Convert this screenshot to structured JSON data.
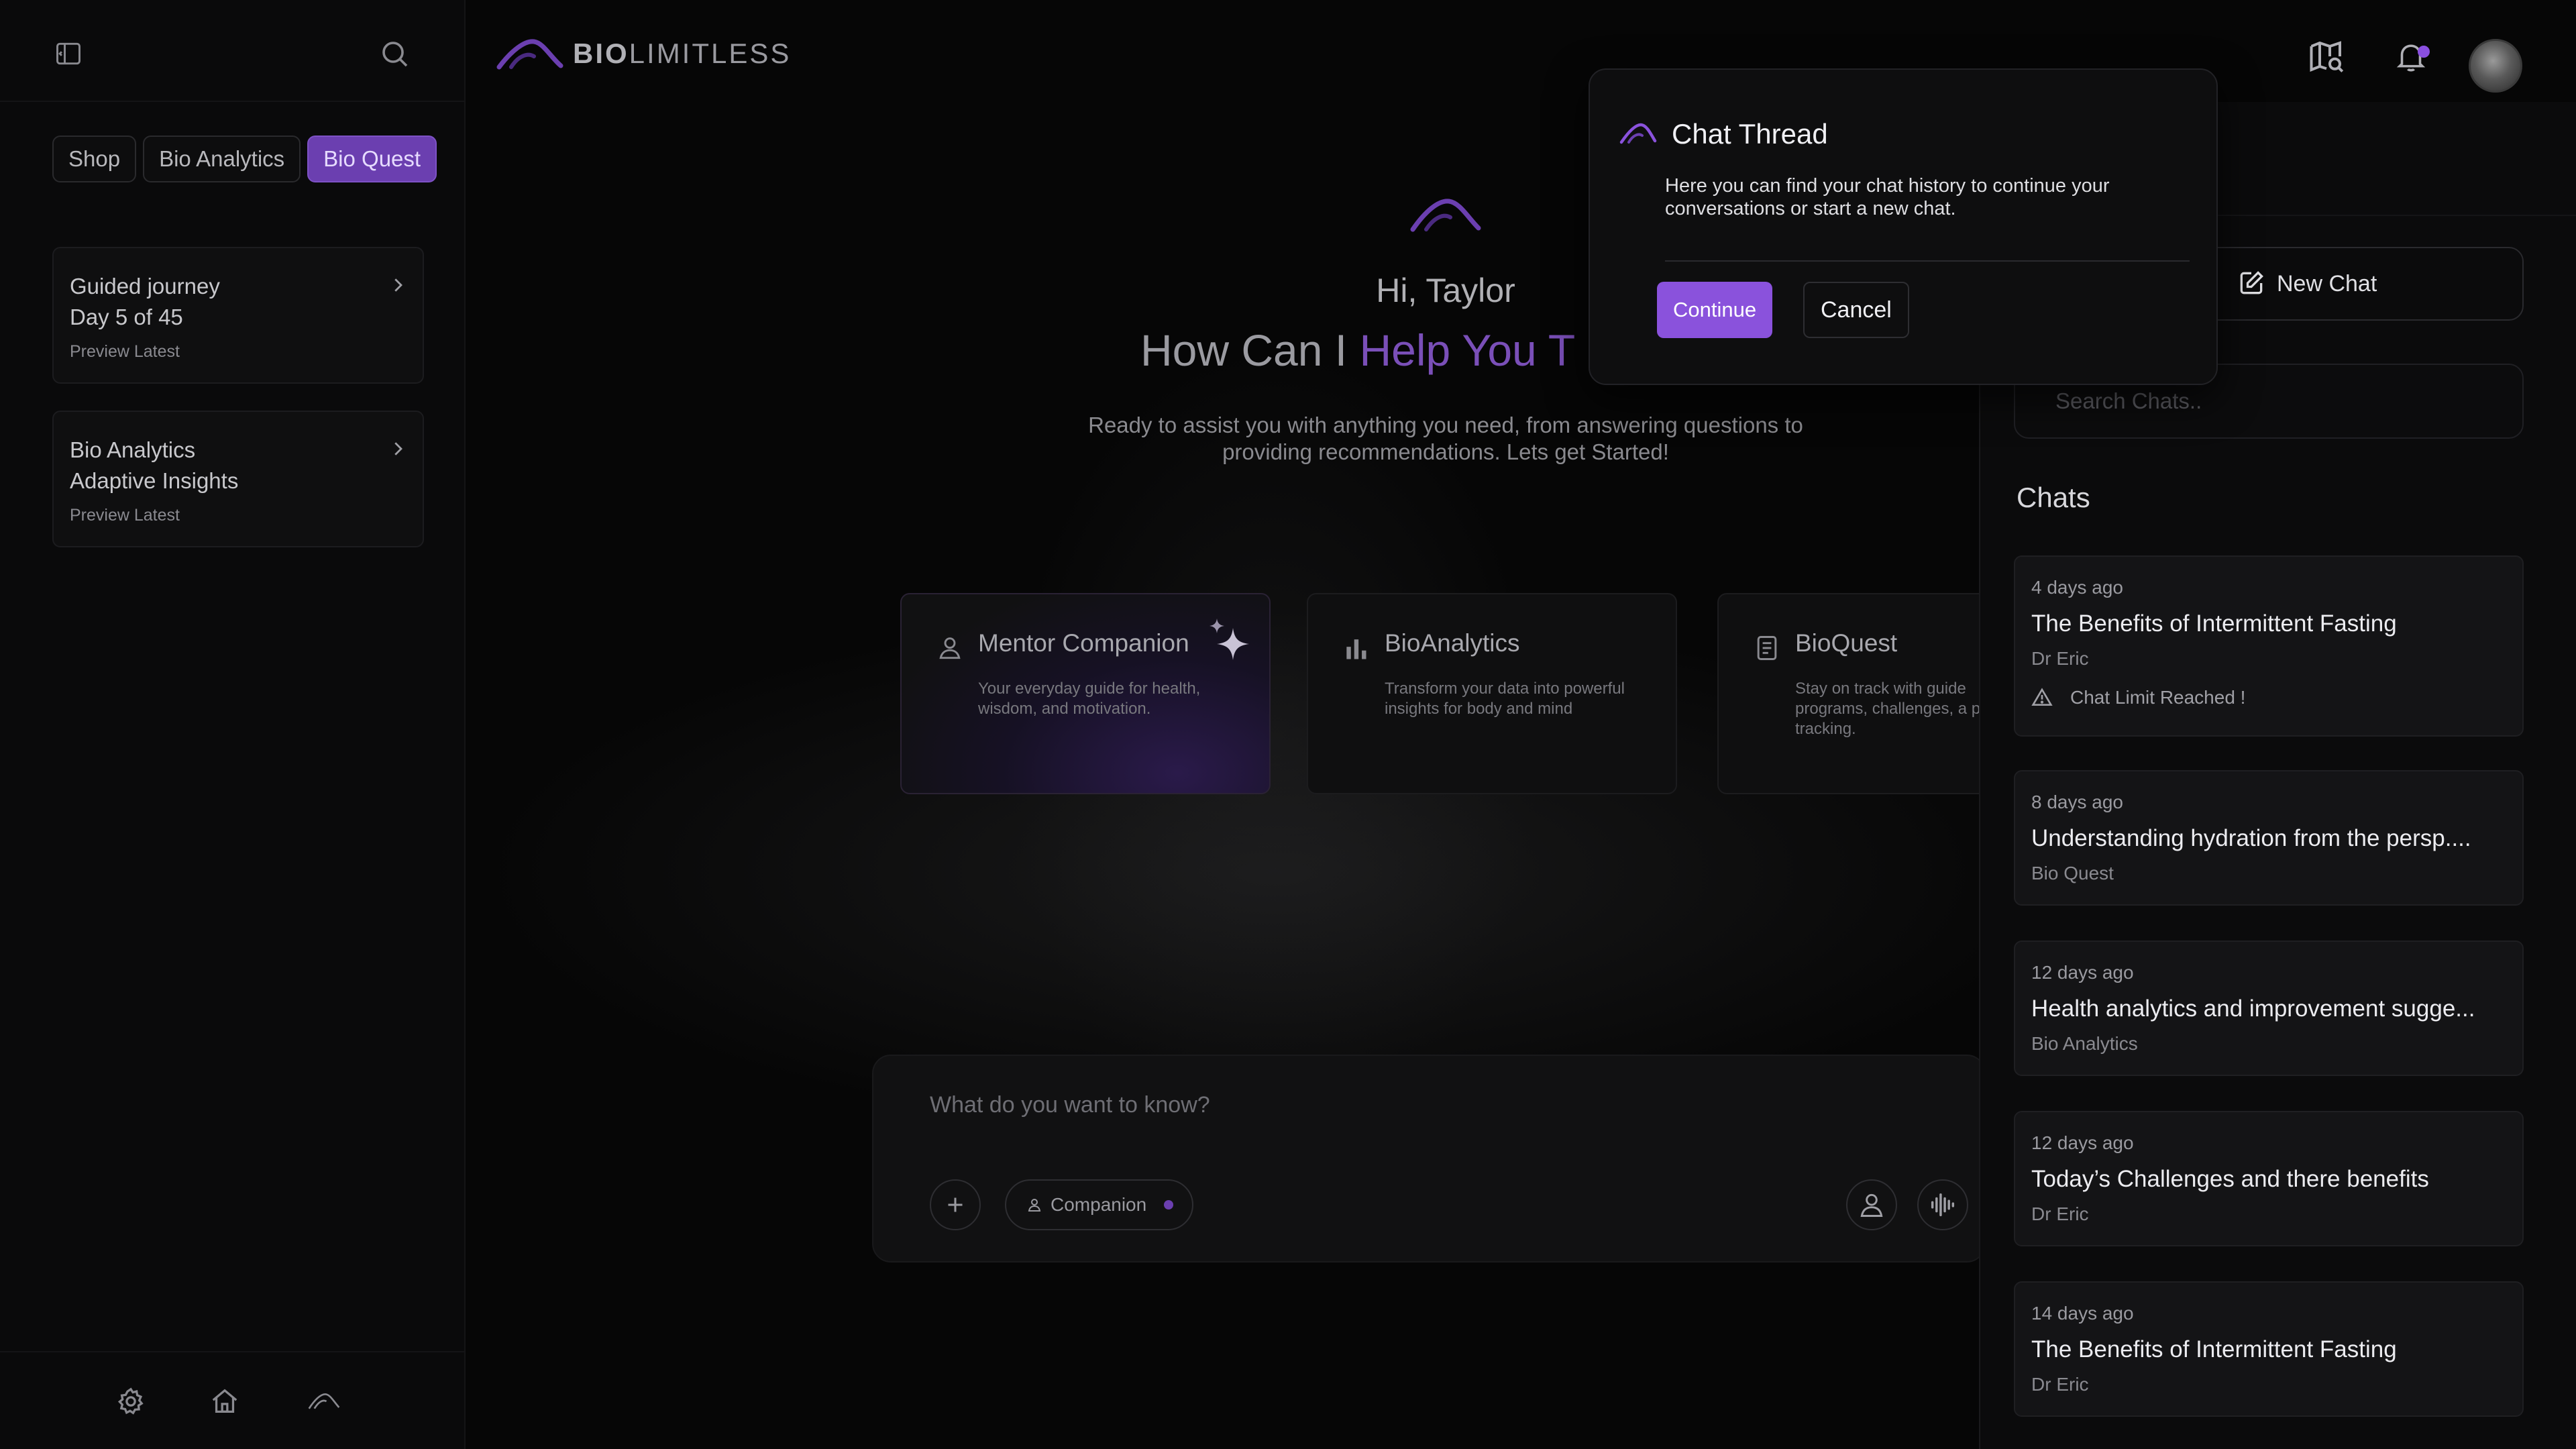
{
  "brand": {
    "name_bold": "BIO",
    "name_rest": "LIMITLESS",
    "accent": "#6b3fb0"
  },
  "sidebar": {
    "tabs": [
      {
        "label": "Shop",
        "active": false
      },
      {
        "label": "Bio Analytics",
        "active": false
      },
      {
        "label": "Bio Quest",
        "active": true
      }
    ],
    "cards": [
      {
        "line1": "Guided journey",
        "line2": "Day 5 of 45",
        "preview": "Preview Latest"
      },
      {
        "line1": "Bio Analytics",
        "line2": "Adaptive Insights",
        "preview": "Preview Latest"
      }
    ],
    "bottom_icons": [
      "settings-icon",
      "home-icon",
      "biolimitless-logo-icon"
    ]
  },
  "header": {
    "icons": [
      "map-search-icon",
      "bell-icon"
    ],
    "has_notification": true
  },
  "hero": {
    "greeting": "Hi, Taylor",
    "headline_prefix": "How Can I ",
    "headline_accent": "Help You T",
    "subtitle": "Ready to assist you with anything you need, from answering questions to providing recommendations. Lets get Started!"
  },
  "features": [
    {
      "title": "Mentor Companion",
      "desc": "Your everyday guide for health, wisdom, and motivation.",
      "icon": "person-icon"
    },
    {
      "title": "BioAnalytics",
      "desc": "Transform your data into powerful insights for body and mind",
      "icon": "bar-chart-icon"
    },
    {
      "title": "BioQuest",
      "desc": "Stay on track with guide programs, challenges, a progress tracking.",
      "icon": "document-icon"
    }
  ],
  "composer": {
    "placeholder": "What do you want to know?",
    "mode_label": "Companion"
  },
  "chat_panel": {
    "new_chat_label": "New Chat",
    "search_placeholder": "Search Chats..",
    "chats_heading": "Chats",
    "items": [
      {
        "ago": "4 days ago",
        "title": "The Benefits of Intermittent Fasting",
        "who": "Dr Eric",
        "warning": "Chat Limit Reached !"
      },
      {
        "ago": "8 days ago",
        "title": "Understanding hydration from the persp....",
        "who": "Bio Quest"
      },
      {
        "ago": "12 days ago",
        "title": "Health analytics and improvement sugge...",
        "who": "Bio Analytics"
      },
      {
        "ago": "12 days ago",
        "title": "Today’s Challenges and there benefits",
        "who": "Dr Eric"
      },
      {
        "ago": "14 days ago",
        "title": "The Benefits of Intermittent Fasting",
        "who": "Dr Eric"
      }
    ]
  },
  "popover": {
    "title": "Chat Thread",
    "description": "Here you can find your chat history to continue your conversations or start a new chat.",
    "continue_label": "Continue",
    "cancel_label": "Cancel"
  }
}
